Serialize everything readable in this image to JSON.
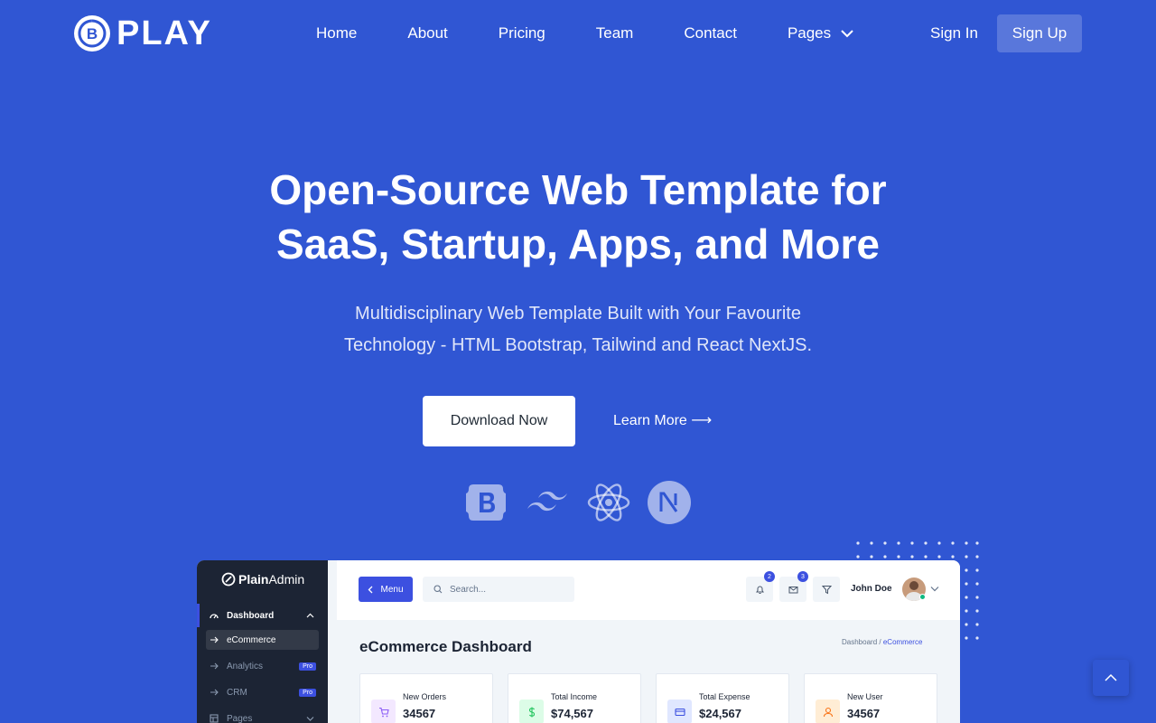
{
  "brand": {
    "name": "PLAY",
    "mark_letter": "B"
  },
  "nav": {
    "items": [
      "Home",
      "About",
      "Pricing",
      "Team",
      "Contact"
    ],
    "pages_label": "Pages",
    "sign_in": "Sign In",
    "sign_up": "Sign Up"
  },
  "hero": {
    "title_line1": "Open-Source Web Template for",
    "title_line2": "SaaS, Startup, Apps, and More",
    "subtitle_line1": "Multidisciplinary Web Template Built with Your Favourite",
    "subtitle_line2": "Technology - HTML Bootstrap, Tailwind and React NextJS.",
    "download_label": "Download Now",
    "learn_more_label": "Learn More ⟶",
    "tech_icons": [
      "bootstrap-icon",
      "tailwind-icon",
      "react-icon",
      "nextjs-icon"
    ]
  },
  "preview": {
    "sidebar": {
      "logo_bold": "Plain",
      "logo_light": "Admin",
      "items": [
        {
          "label": "Dashboard"
        },
        {
          "label": "eCommerce"
        },
        {
          "label": "Analytics",
          "badge": "Pro"
        },
        {
          "label": "CRM",
          "badge": "Pro"
        },
        {
          "label": "Pages"
        }
      ]
    },
    "topbar": {
      "menu_label": "Menu",
      "search_placeholder": "Search...",
      "notification_count": "2",
      "message_count": "3",
      "user_name": "John Doe"
    },
    "page_title": "eCommerce Dashboard",
    "breadcrumb": {
      "root": "Dashboard",
      "separator": "/",
      "current": "eCommerce"
    },
    "cards": [
      {
        "label": "New Orders",
        "value": "34567",
        "icon": "cart-icon",
        "color": "#8b5cf6",
        "bg": "#f3e8ff"
      },
      {
        "label": "Total Income",
        "value": "$74,567",
        "icon": "dollar-icon",
        "color": "#22c55e",
        "bg": "#dcfce7"
      },
      {
        "label": "Total Expense",
        "value": "$24,567",
        "icon": "card-icon",
        "color": "#3c50e0",
        "bg": "#e0e7ff"
      },
      {
        "label": "New User",
        "value": "34567",
        "icon": "user-icon",
        "color": "#f97316",
        "bg": "#ffedd5"
      }
    ]
  },
  "colors": {
    "background": "#3056D3",
    "accent": "#3C50E0",
    "sidebar": "#1C2434"
  }
}
